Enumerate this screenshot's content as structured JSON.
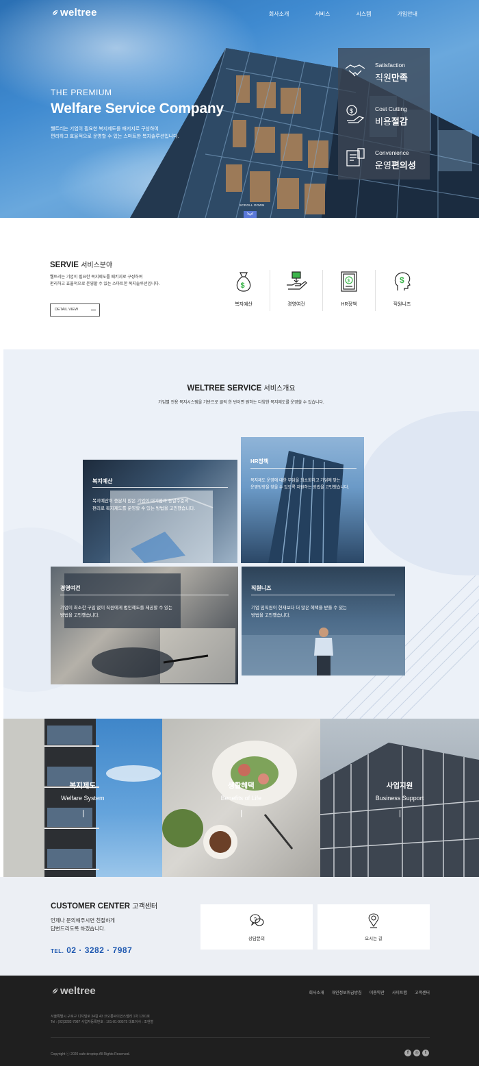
{
  "header": {
    "logo": "weltree",
    "nav": [
      "회사소개",
      "서비스",
      "시스템",
      "가입안내"
    ]
  },
  "hero": {
    "subtitle": "THE PREMIUM",
    "title": "Welfare Service Company",
    "desc_line1": "웰트리는 기업이 필요한 복지제도를 패키지로 구성하여",
    "desc_line2": "편리하고 효율적으로 운영할 수 있는 스마트한 복지솔루션입니다.",
    "features": [
      {
        "en": "Satisfaction",
        "ko_light": "직원",
        "ko_bold": "만족",
        "icon": "handshake-icon"
      },
      {
        "en": "Cost Cutting",
        "ko_light": "비용",
        "ko_bold": "절감",
        "icon": "money-hand-icon"
      },
      {
        "en": "Convenience",
        "ko_light": "운영",
        "ko_bold": "편의성",
        "icon": "document-icon"
      }
    ],
    "scroll_label": "SCROLL DOWN",
    "scroll_icon": "chevron-down-icon"
  },
  "service": {
    "title_en": "SERVIE",
    "title_ko": "서비스분야",
    "desc_line1": "웰트리는 기업이 필요한 복지제도를 패키지로 구성하여",
    "desc_line2": "편리하고 효율적으로 운영할 수 있는 스마트한 복지솔루션입니다.",
    "detail_button": "DETAIL VIEW",
    "items": [
      {
        "label": "복지예산",
        "icon": "money-bag-icon"
      },
      {
        "label": "경영여건",
        "icon": "hand-money-icon"
      },
      {
        "label": "HR정책",
        "icon": "certificate-icon"
      },
      {
        "label": "직원니즈",
        "icon": "head-dollar-icon"
      }
    ]
  },
  "overview": {
    "title_en": "WELTREE SERVICE",
    "title_ko": "서비스개요",
    "desc": "가입별 전용 복지시스템을 기반으로 클릭 한 번이면 원하는 다양한 복지제도를 운영할 수 있습니다.",
    "cards": [
      {
        "title": "복지예산",
        "desc_line1": "복지예산이 충분치 않은 기업이 대기업과 동일수준의",
        "desc_line2": "편리로 복지제도를 운영할 수 있는 방법을 고민했습니다."
      },
      {
        "title": "HR정책",
        "desc_line1": "복지제도 운영에 대한 부담을 최소화하고 기업에 맞는",
        "desc_line2": "운영방향을 찾을 수 있도록 지원하는 방법을 고민했습니다."
      },
      {
        "title": "경영여건",
        "desc_line1": "기업이 최소한 구입 없이 직원에게 법인혜도를 제공할 수 있는",
        "desc_line2": "방법을 고민했습니다."
      },
      {
        "title": "직원니즈",
        "desc_line1": "기업 임직원이 현재보다 더 많은 혜택을 받을 수 있는",
        "desc_line2": "방법을 고민했습니다."
      }
    ]
  },
  "banners": [
    {
      "title": "복지제도",
      "sub": "Welfare System"
    },
    {
      "title": "생활혜택",
      "sub": "Benefits of Life"
    },
    {
      "title": "사업지원",
      "sub": "Business Support"
    }
  ],
  "customer": {
    "title_en": "CUSTOMER CENTER",
    "title_ko": "고객센터",
    "desc_line1": "언제나 문의해주시면 친절하게",
    "desc_line2": "답변드리도록 하겠습니다.",
    "tel_label": "TEL.",
    "tel_number": "02 · 3282 · 7987",
    "boxes": [
      {
        "label": "상담문의",
        "icon": "chat-icon"
      },
      {
        "label": "오시는 길",
        "icon": "location-pin-icon"
      }
    ]
  },
  "footer": {
    "logo": "weltree",
    "nav": [
      "회사소개",
      "개인정보취급방침",
      "이용약관",
      "사이트맵",
      "고객센터"
    ],
    "addr_line1": "서울특별시 구로구 디지털로 34길 43 코오롱싸이언스밸리 1차 1201호",
    "addr_line2": "Tel : (02)3282-7987     사업자등록번호 : 101-81-90575     대표이사 : 조현철",
    "copyright": "Copyright ⓒ 2020 cafe droptop All Rights Reserved.",
    "sns": [
      "facebook-icon",
      "instagram-icon",
      "twitter-icon"
    ]
  }
}
